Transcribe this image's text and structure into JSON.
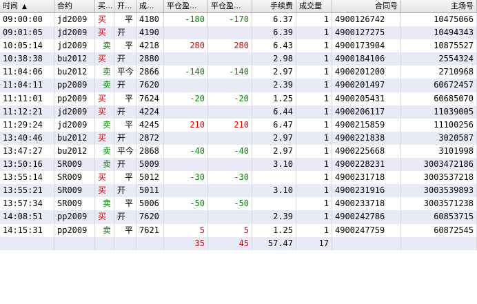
{
  "headers": {
    "time": "时间",
    "contract": "合约",
    "buysell": "买...",
    "openclose": "开...",
    "deal_price": "成...",
    "close_pnl1": "平仓盈...",
    "close_pnl2": "平仓盈...",
    "fee": "手续费",
    "volume": "成交量",
    "contract_no": "合同号",
    "exchange_no": "主场号"
  },
  "rows": [
    {
      "time": "09:00:00",
      "contract": "jd2009",
      "bs": "买",
      "oc": "平",
      "price": "4180",
      "p1": "-180",
      "p2": "-170",
      "fee": "6.37",
      "vol": "1",
      "cno": "4900126742",
      "eno": "10475066"
    },
    {
      "time": "09:01:05",
      "contract": "jd2009",
      "bs": "买",
      "oc": "开",
      "price": "4190",
      "p1": "",
      "p2": "",
      "fee": "6.39",
      "vol": "1",
      "cno": "4900127275",
      "eno": "10494343"
    },
    {
      "time": "10:05:14",
      "contract": "jd2009",
      "bs": "卖",
      "oc": "平",
      "price": "4218",
      "p1": "280",
      "p2": "280",
      "fee": "6.43",
      "vol": "1",
      "cno": "4900173904",
      "eno": "10875527"
    },
    {
      "time": "10:38:38",
      "contract": "bu2012",
      "bs": "买",
      "oc": "开",
      "price": "2880",
      "p1": "",
      "p2": "",
      "fee": "2.98",
      "vol": "1",
      "cno": "4900184106",
      "eno": "2554324"
    },
    {
      "time": "11:04:06",
      "contract": "bu2012",
      "bs": "卖",
      "oc": "平今",
      "price": "2866",
      "p1": "-140",
      "p2": "-140",
      "fee": "2.97",
      "vol": "1",
      "cno": "4900201200",
      "eno": "2710968"
    },
    {
      "time": "11:04:11",
      "contract": "pp2009",
      "bs": "卖",
      "oc": "开",
      "price": "7620",
      "p1": "",
      "p2": "",
      "fee": "2.39",
      "vol": "1",
      "cno": "4900201497",
      "eno": "60672457"
    },
    {
      "time": "11:11:01",
      "contract": "pp2009",
      "bs": "买",
      "oc": "平",
      "price": "7624",
      "p1": "-20",
      "p2": "-20",
      "fee": "1.25",
      "vol": "1",
      "cno": "4900205431",
      "eno": "60685070"
    },
    {
      "time": "11:12:21",
      "contract": "jd2009",
      "bs": "买",
      "oc": "开",
      "price": "4224",
      "p1": "",
      "p2": "",
      "fee": "6.44",
      "vol": "1",
      "cno": "4900206117",
      "eno": "11039005"
    },
    {
      "time": "11:29:24",
      "contract": "jd2009",
      "bs": "卖",
      "oc": "平",
      "price": "4245",
      "p1": "210",
      "p2": "210",
      "fee": "6.47",
      "vol": "1",
      "cno": "4900215859",
      "eno": "11100256"
    },
    {
      "time": "13:40:46",
      "contract": "bu2012",
      "bs": "买",
      "oc": "开",
      "price": "2872",
      "p1": "",
      "p2": "",
      "fee": "2.97",
      "vol": "1",
      "cno": "4900221838",
      "eno": "3020587"
    },
    {
      "time": "13:47:27",
      "contract": "bu2012",
      "bs": "卖",
      "oc": "平今",
      "price": "2868",
      "p1": "-40",
      "p2": "-40",
      "fee": "2.97",
      "vol": "1",
      "cno": "4900225668",
      "eno": "3101998"
    },
    {
      "time": "13:50:16",
      "contract": "SR009",
      "bs": "卖",
      "oc": "开",
      "price": "5009",
      "p1": "",
      "p2": "",
      "fee": "3.10",
      "vol": "1",
      "cno": "4900228231",
      "eno": "3003472186"
    },
    {
      "time": "13:55:14",
      "contract": "SR009",
      "bs": "买",
      "oc": "平",
      "price": "5012",
      "p1": "-30",
      "p2": "-30",
      "fee": "",
      "vol": "1",
      "cno": "4900231718",
      "eno": "3003537218"
    },
    {
      "time": "13:55:21",
      "contract": "SR009",
      "bs": "买",
      "oc": "开",
      "price": "5011",
      "p1": "",
      "p2": "",
      "fee": "3.10",
      "vol": "1",
      "cno": "4900231916",
      "eno": "3003539893"
    },
    {
      "time": "13:57:34",
      "contract": "SR009",
      "bs": "卖",
      "oc": "平",
      "price": "5006",
      "p1": "-50",
      "p2": "-50",
      "fee": "",
      "vol": "1",
      "cno": "4900233718",
      "eno": "3003571238"
    },
    {
      "time": "14:08:51",
      "contract": "pp2009",
      "bs": "买",
      "oc": "开",
      "price": "7620",
      "p1": "",
      "p2": "",
      "fee": "2.39",
      "vol": "1",
      "cno": "4900242786",
      "eno": "60853715"
    },
    {
      "time": "14:15:31",
      "contract": "pp2009",
      "bs": "卖",
      "oc": "平",
      "price": "7621",
      "p1": "5",
      "p2": "5",
      "fee": "1.25",
      "vol": "1",
      "cno": "4900247759",
      "eno": "60872545"
    }
  ],
  "totals": {
    "p1": "35",
    "p2": "45",
    "fee": "57.47",
    "vol": "17"
  },
  "colors": {
    "buy": "#e00000",
    "sell": "#008800",
    "alt_row": "#e8eaf6",
    "header": "#e3e3e3"
  }
}
